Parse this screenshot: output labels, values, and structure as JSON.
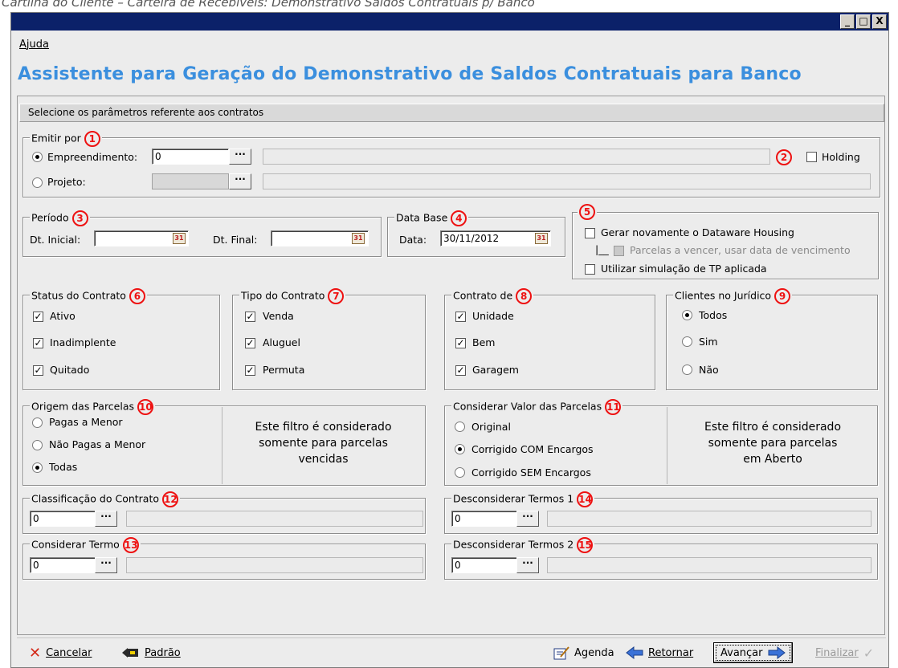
{
  "caption": "Cartilha do Cliente – Carteira de Recebíveis: Demonstrativo Saldos Contratuais p/ Banco",
  "window": {
    "min": "_",
    "max": "□",
    "close": "X"
  },
  "menu": {
    "help": "Ajuda"
  },
  "title": "Assistente para Geração do Demonstrativo de Saldos Contratuais para Banco",
  "panel_header": "Selecione os parâmetros referente aos contratos",
  "emitir": {
    "legend": "Emitir por",
    "badge": "1",
    "empreendimento_label": "Empreendimento:",
    "empreendimento_value": "0",
    "projeto_label": "Projeto:",
    "badge2": "2",
    "holding_label": "Holding",
    "selected": "empreendimento"
  },
  "periodo": {
    "legend": "Período",
    "badge": "3",
    "dt_inicial_label": "Dt. Inicial:",
    "dt_final_label": "Dt. Final:",
    "dt_inicial": "",
    "dt_final": ""
  },
  "database": {
    "legend": "Data Base",
    "badge": "4",
    "data_label": "Data:",
    "data_value": "30/11/2012"
  },
  "opcoes": {
    "badge": "5",
    "gerar": "Gerar novamente o Dataware Housing",
    "parcelas_prefix": "|__",
    "parcelas": "Parcelas a vencer, usar data de vencimento",
    "simulacao": "Utilizar simulação de TP aplicada"
  },
  "status": {
    "legend": "Status do Contrato",
    "badge": "6",
    "items": [
      "Ativo",
      "Inadimplente",
      "Quitado"
    ]
  },
  "tipo": {
    "legend": "Tipo do Contrato",
    "badge": "7",
    "items": [
      "Venda",
      "Aluguel",
      "Permuta"
    ]
  },
  "contratode": {
    "legend": "Contrato de",
    "badge": "8",
    "items": [
      "Unidade",
      "Bem",
      "Garagem"
    ]
  },
  "juridico": {
    "legend": "Clientes no Jurídico",
    "badge": "9",
    "items": [
      "Todos",
      "Sim",
      "Não"
    ],
    "selected": "Todos"
  },
  "origem": {
    "legend": "Origem das Parcelas",
    "badge": "10",
    "items": [
      "Pagas a Menor",
      "Não Pagas a Menor",
      "Todas"
    ],
    "selected": "Todas",
    "note": [
      "Este filtro é considerado",
      "somente para parcelas",
      "vencidas"
    ]
  },
  "valor": {
    "legend": "Considerar Valor das Parcelas",
    "badge": "11",
    "items": [
      "Original",
      "Corrigido COM Encargos",
      "Corrigido SEM Encargos"
    ],
    "selected": "Corrigido COM Encargos",
    "note": [
      "Este filtro é considerado",
      "somente para parcelas",
      "em Aberto"
    ]
  },
  "classificacao": {
    "legend": "Classificação do Contrato",
    "badge": "12",
    "value": "0"
  },
  "termo": {
    "legend": "Considerar Termo",
    "badge": "13",
    "value": "0"
  },
  "desc1": {
    "legend": "Desconsiderar Termos 1",
    "badge": "14",
    "value": "0"
  },
  "desc2": {
    "legend": "Desconsiderar Termos 2",
    "badge": "15",
    "value": "0"
  },
  "buttons": {
    "cancelar": "Cancelar",
    "padrao": "Padrão",
    "agenda": "Agenda",
    "retornar": "Retornar",
    "avancar": "Avançar",
    "finalizar": "Finalizar"
  },
  "colors": {
    "title": "#3b8fde",
    "titlebar": "#0b2169",
    "badge": "#e11111",
    "cancel_icon": "#d42a1a",
    "arrow": "#3a72d8"
  },
  "icons": [
    "cancel-x-icon",
    "default-icon",
    "agenda-icon",
    "back-arrow-icon",
    "forward-arrow-icon",
    "check-icon",
    "calendar-icon"
  ]
}
